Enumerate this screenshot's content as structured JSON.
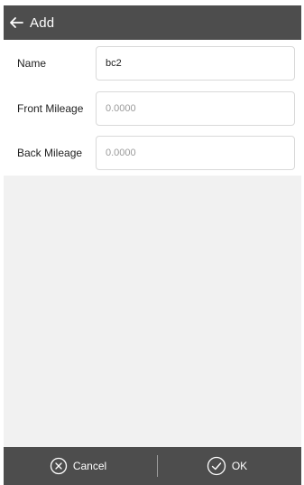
{
  "header": {
    "title": "Add",
    "back_icon": "arrow-left-icon"
  },
  "form": {
    "name": {
      "label": "Name",
      "value": "bc2"
    },
    "front_mileage": {
      "label": "Front Mileage",
      "placeholder": "0.0000"
    },
    "back_mileage": {
      "label": "Back Mileage",
      "placeholder": "0.0000"
    }
  },
  "footer": {
    "cancel": {
      "label": "Cancel",
      "icon": "close-circle-icon"
    },
    "ok": {
      "label": "OK",
      "icon": "check-circle-icon"
    }
  },
  "colors": {
    "bar": "#4d4d4d",
    "background": "#f1f1f1"
  }
}
